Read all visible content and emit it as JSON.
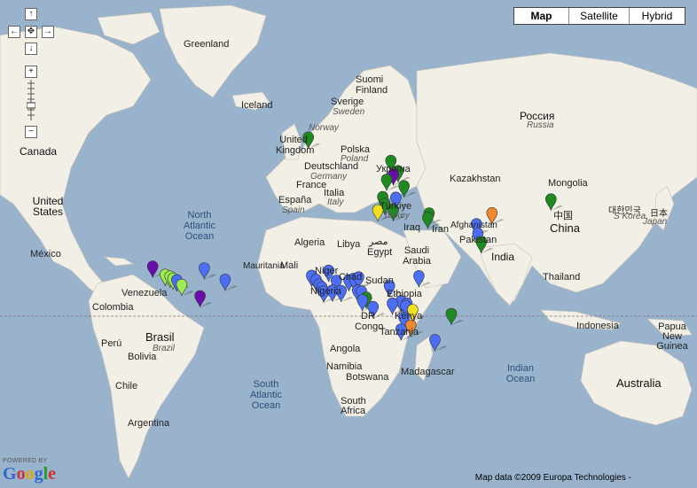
{
  "map_type_control": {
    "buttons": [
      {
        "label": "Map",
        "active": true
      },
      {
        "label": "Satellite",
        "active": false
      },
      {
        "label": "Hybrid",
        "active": false
      }
    ]
  },
  "nav_control": {
    "pan_up": "↑",
    "pan_left": "←",
    "pan_center": "✥",
    "pan_right": "→",
    "pan_down": "↓",
    "zoom_in": "+",
    "zoom_out": "−"
  },
  "labels": {
    "greenland": "Greenland",
    "iceland": "Iceland",
    "canada": "Canada",
    "united_states": "United States",
    "mexico": "México",
    "venezuela": "Venezuela",
    "colombia": "Colombia",
    "peru": "Perú",
    "brasil": "Brasil",
    "brazil": "Brazil",
    "bolivia": "Bolivia",
    "chile": "Chile",
    "argentina": "Argentina",
    "north_atlantic_ocean": "North Atlantic Ocean",
    "south_atlantic_ocean": "South Atlantic Ocean",
    "indian_ocean": "Indian Ocean",
    "sverige": "Sverige",
    "sweden": "Sweden",
    "suomi": "Suomi",
    "finland": "Finland",
    "norway": "Norway",
    "united_kingdom": "United Kingdom",
    "polska": "Polska",
    "poland": "Poland",
    "deutschland": "Deutschland",
    "germany": "Germany",
    "france": "France",
    "espana": "España",
    "spain": "Spain",
    "italia": "Italia",
    "italy": "Italy",
    "ukraina": "Україна",
    "turkiye": "Türkiye",
    "turkey": "Turkey",
    "rossiya": "Россия",
    "russia": "Russia",
    "kazakhstan": "Kazakhstan",
    "mongolia": "Mongolia",
    "china_native": "中国",
    "china": "China",
    "south_korea_native": "대한민국",
    "south_korea": "S Korea",
    "japan_native": "日本",
    "japan": "Japan",
    "afghanistan": "Afghanistan",
    "pakistan": "Pakistan",
    "iraq": "Iraq",
    "iran": "Iran",
    "india": "India",
    "thailand": "Thailand",
    "indonesia": "Indonesia",
    "papua_new_guinea": "Papua New Guinea",
    "australia": "Australia",
    "algeria": "Algeria",
    "libya": "Libya",
    "misr": "مصر",
    "egypt": "Egypt",
    "saudi_arabia": "Saudi Arabia",
    "mauritania": "Mauritania",
    "mali": "Mali",
    "niger": "Niger",
    "chad": "Chad",
    "sudan": "Sudan",
    "nigeria": "Nigeria",
    "ethiopia": "Ethiopia",
    "dr_congo": "DR Congo",
    "kenya": "Kenya",
    "tanzania": "Tanzania",
    "angola": "Angola",
    "namibia": "Namibia",
    "botswana": "Botswana",
    "south_africa": "South Africa",
    "madagascar": "Madagascar"
  },
  "markers": [
    {
      "lng": -18.5,
      "lat": 65.2,
      "color": "#1f8a1f"
    },
    {
      "lng": 24.2,
      "lat": 59.6,
      "color": "#1f8a1f"
    },
    {
      "lng": 28.0,
      "lat": 56.8,
      "color": "#1f8a1f"
    },
    {
      "lng": 25.5,
      "lat": 55.9,
      "color": "#6a0dad"
    },
    {
      "lng": 22.0,
      "lat": 54.3,
      "color": "#1f8a1f"
    },
    {
      "lng": 31.0,
      "lat": 52.3,
      "color": "#1f8a1f"
    },
    {
      "lng": 26.8,
      "lat": 48.5,
      "color": "#4b6ef5"
    },
    {
      "lng": 20.0,
      "lat": 48.7,
      "color": "#1f8a1f"
    },
    {
      "lng": 21.0,
      "lat": 46.4,
      "color": "#1f8a1f"
    },
    {
      "lng": 17.5,
      "lat": 44.0,
      "color": "#f0e020"
    },
    {
      "lng": 25.5,
      "lat": 44.1,
      "color": "#1f8a1f"
    },
    {
      "lng": 44.0,
      "lat": 42.8,
      "color": "#1f8a1f"
    },
    {
      "lng": 43.3,
      "lat": 41.2,
      "color": "#1f8a1f"
    },
    {
      "lng": 76.5,
      "lat": 42.9,
      "color": "#f08a30"
    },
    {
      "lng": 68.5,
      "lat": 38.6,
      "color": "#4b6ef5"
    },
    {
      "lng": 69.2,
      "lat": 34.6,
      "color": "#4b6ef5"
    },
    {
      "lng": 71.0,
      "lat": 31.0,
      "color": "#1f8a1f"
    },
    {
      "lng": 107.0,
      "lat": 47.9,
      "color": "#1f8a1f"
    },
    {
      "lng": -99.0,
      "lat": 19.5,
      "color": "#6a0dad"
    },
    {
      "lng": -92.5,
      "lat": 15.5,
      "color": "#9bed4f"
    },
    {
      "lng": -90.0,
      "lat": 14.6,
      "color": "#9bed4f"
    },
    {
      "lng": -88.5,
      "lat": 13.6,
      "color": "#9bed4f"
    },
    {
      "lng": -86.5,
      "lat": 12.8,
      "color": "#4b6ef5"
    },
    {
      "lng": -84.0,
      "lat": 10.4,
      "color": "#9bed4f"
    },
    {
      "lng": -72.3,
      "lat": 18.7,
      "color": "#4b6ef5"
    },
    {
      "lng": -61.5,
      "lat": 13.0,
      "color": "#4b6ef5"
    },
    {
      "lng": -74.5,
      "lat": 4.6,
      "color": "#6a0dad"
    },
    {
      "lng": -16.8,
      "lat": 15.0,
      "color": "#4b6ef5"
    },
    {
      "lng": -14.5,
      "lat": 13.0,
      "color": "#4b6ef5"
    },
    {
      "lng": -13.0,
      "lat": 10.6,
      "color": "#4b6ef5"
    },
    {
      "lng": -11.5,
      "lat": 9.2,
      "color": "#4b6ef5"
    },
    {
      "lng": -10.5,
      "lat": 7.0,
      "color": "#4b6ef5"
    },
    {
      "lng": -8.0,
      "lat": 17.5,
      "color": "#4b6ef5"
    },
    {
      "lng": -4.0,
      "lat": 12.5,
      "color": "#4b6ef5"
    },
    {
      "lng": -6.0,
      "lat": 7.5,
      "color": "#4b6ef5"
    },
    {
      "lng": -1.5,
      "lat": 7.3,
      "color": "#4b6ef5"
    },
    {
      "lng": 2.5,
      "lat": 12.8,
      "color": "#4b6ef5"
    },
    {
      "lng": 5.0,
      "lat": 13.5,
      "color": "#4b6ef5"
    },
    {
      "lng": 7.5,
      "lat": 14.2,
      "color": "#4b6ef5"
    },
    {
      "lng": 7.0,
      "lat": 7.5,
      "color": "#4b6ef5"
    },
    {
      "lng": 9.0,
      "lat": 7.0,
      "color": "#4b6ef5"
    },
    {
      "lng": 11.5,
      "lat": 3.8,
      "color": "#1f8a1f"
    },
    {
      "lng": 9.5,
      "lat": 2.5,
      "color": "#4b6ef5"
    },
    {
      "lng": 15.0,
      "lat": -1.0,
      "color": "#4b6ef5"
    },
    {
      "lng": 23.5,
      "lat": 9.8,
      "color": "#4b6ef5"
    },
    {
      "lng": 38.7,
      "lat": 14.8,
      "color": "#4b6ef5"
    },
    {
      "lng": 29.5,
      "lat": 2.0,
      "color": "#4b6ef5"
    },
    {
      "lng": 32.5,
      "lat": 0.8,
      "color": "#4b6ef5"
    },
    {
      "lng": 31.8,
      "lat": -0.5,
      "color": "#4b6ef5"
    },
    {
      "lng": 35.5,
      "lat": -2.5,
      "color": "#f0e020"
    },
    {
      "lng": 31.0,
      "lat": -6.5,
      "color": "#4b6ef5"
    },
    {
      "lng": 34.5,
      "lat": -10.5,
      "color": "#f08a30"
    },
    {
      "lng": 29.5,
      "lat": -12.5,
      "color": "#4b6ef5"
    },
    {
      "lng": 25.0,
      "lat": 0.8,
      "color": "#4b6ef5"
    },
    {
      "lng": 47.0,
      "lat": -17.8,
      "color": "#4b6ef5"
    },
    {
      "lng": 55.5,
      "lat": -4.6,
      "color": "#1f8a1f"
    }
  ]
}
